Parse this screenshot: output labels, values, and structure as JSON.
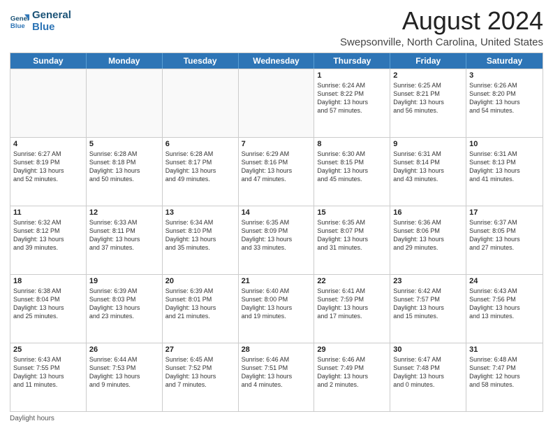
{
  "logo": {
    "line1": "General",
    "line2": "Blue"
  },
  "title": "August 2024",
  "subtitle": "Swepsonville, North Carolina, United States",
  "weekdays": [
    "Sunday",
    "Monday",
    "Tuesday",
    "Wednesday",
    "Thursday",
    "Friday",
    "Saturday"
  ],
  "footer": "Daylight hours",
  "weeks": [
    [
      {
        "day": "",
        "info": "",
        "empty": true
      },
      {
        "day": "",
        "info": "",
        "empty": true
      },
      {
        "day": "",
        "info": "",
        "empty": true
      },
      {
        "day": "",
        "info": "",
        "empty": true
      },
      {
        "day": "1",
        "info": "Sunrise: 6:24 AM\nSunset: 8:22 PM\nDaylight: 13 hours\nand 57 minutes."
      },
      {
        "day": "2",
        "info": "Sunrise: 6:25 AM\nSunset: 8:21 PM\nDaylight: 13 hours\nand 56 minutes."
      },
      {
        "day": "3",
        "info": "Sunrise: 6:26 AM\nSunset: 8:20 PM\nDaylight: 13 hours\nand 54 minutes."
      }
    ],
    [
      {
        "day": "4",
        "info": "Sunrise: 6:27 AM\nSunset: 8:19 PM\nDaylight: 13 hours\nand 52 minutes."
      },
      {
        "day": "5",
        "info": "Sunrise: 6:28 AM\nSunset: 8:18 PM\nDaylight: 13 hours\nand 50 minutes."
      },
      {
        "day": "6",
        "info": "Sunrise: 6:28 AM\nSunset: 8:17 PM\nDaylight: 13 hours\nand 49 minutes."
      },
      {
        "day": "7",
        "info": "Sunrise: 6:29 AM\nSunset: 8:16 PM\nDaylight: 13 hours\nand 47 minutes."
      },
      {
        "day": "8",
        "info": "Sunrise: 6:30 AM\nSunset: 8:15 PM\nDaylight: 13 hours\nand 45 minutes."
      },
      {
        "day": "9",
        "info": "Sunrise: 6:31 AM\nSunset: 8:14 PM\nDaylight: 13 hours\nand 43 minutes."
      },
      {
        "day": "10",
        "info": "Sunrise: 6:31 AM\nSunset: 8:13 PM\nDaylight: 13 hours\nand 41 minutes."
      }
    ],
    [
      {
        "day": "11",
        "info": "Sunrise: 6:32 AM\nSunset: 8:12 PM\nDaylight: 13 hours\nand 39 minutes."
      },
      {
        "day": "12",
        "info": "Sunrise: 6:33 AM\nSunset: 8:11 PM\nDaylight: 13 hours\nand 37 minutes."
      },
      {
        "day": "13",
        "info": "Sunrise: 6:34 AM\nSunset: 8:10 PM\nDaylight: 13 hours\nand 35 minutes."
      },
      {
        "day": "14",
        "info": "Sunrise: 6:35 AM\nSunset: 8:09 PM\nDaylight: 13 hours\nand 33 minutes."
      },
      {
        "day": "15",
        "info": "Sunrise: 6:35 AM\nSunset: 8:07 PM\nDaylight: 13 hours\nand 31 minutes."
      },
      {
        "day": "16",
        "info": "Sunrise: 6:36 AM\nSunset: 8:06 PM\nDaylight: 13 hours\nand 29 minutes."
      },
      {
        "day": "17",
        "info": "Sunrise: 6:37 AM\nSunset: 8:05 PM\nDaylight: 13 hours\nand 27 minutes."
      }
    ],
    [
      {
        "day": "18",
        "info": "Sunrise: 6:38 AM\nSunset: 8:04 PM\nDaylight: 13 hours\nand 25 minutes."
      },
      {
        "day": "19",
        "info": "Sunrise: 6:39 AM\nSunset: 8:03 PM\nDaylight: 13 hours\nand 23 minutes."
      },
      {
        "day": "20",
        "info": "Sunrise: 6:39 AM\nSunset: 8:01 PM\nDaylight: 13 hours\nand 21 minutes."
      },
      {
        "day": "21",
        "info": "Sunrise: 6:40 AM\nSunset: 8:00 PM\nDaylight: 13 hours\nand 19 minutes."
      },
      {
        "day": "22",
        "info": "Sunrise: 6:41 AM\nSunset: 7:59 PM\nDaylight: 13 hours\nand 17 minutes."
      },
      {
        "day": "23",
        "info": "Sunrise: 6:42 AM\nSunset: 7:57 PM\nDaylight: 13 hours\nand 15 minutes."
      },
      {
        "day": "24",
        "info": "Sunrise: 6:43 AM\nSunset: 7:56 PM\nDaylight: 13 hours\nand 13 minutes."
      }
    ],
    [
      {
        "day": "25",
        "info": "Sunrise: 6:43 AM\nSunset: 7:55 PM\nDaylight: 13 hours\nand 11 minutes."
      },
      {
        "day": "26",
        "info": "Sunrise: 6:44 AM\nSunset: 7:53 PM\nDaylight: 13 hours\nand 9 minutes."
      },
      {
        "day": "27",
        "info": "Sunrise: 6:45 AM\nSunset: 7:52 PM\nDaylight: 13 hours\nand 7 minutes."
      },
      {
        "day": "28",
        "info": "Sunrise: 6:46 AM\nSunset: 7:51 PM\nDaylight: 13 hours\nand 4 minutes."
      },
      {
        "day": "29",
        "info": "Sunrise: 6:46 AM\nSunset: 7:49 PM\nDaylight: 13 hours\nand 2 minutes."
      },
      {
        "day": "30",
        "info": "Sunrise: 6:47 AM\nSunset: 7:48 PM\nDaylight: 13 hours\nand 0 minutes."
      },
      {
        "day": "31",
        "info": "Sunrise: 6:48 AM\nSunset: 7:47 PM\nDaylight: 12 hours\nand 58 minutes."
      }
    ]
  ]
}
